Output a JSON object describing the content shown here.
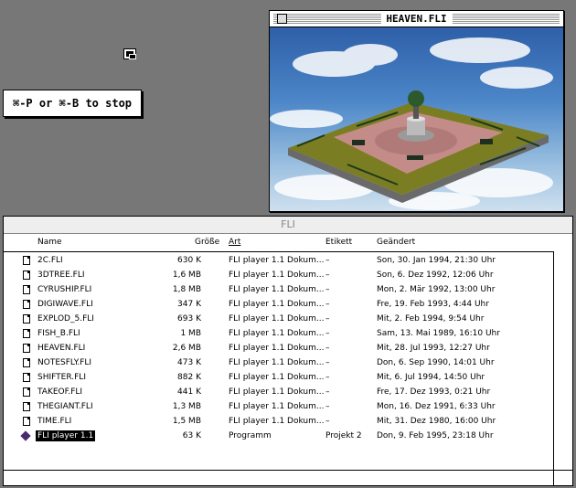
{
  "desktop": {
    "stop_message": "⌘-P or ⌘-B to stop",
    "small_icon": "window-icon"
  },
  "movie_window": {
    "title": "HEAVEN.FLI"
  },
  "finder": {
    "title": "FLI",
    "columns": {
      "name": "Name",
      "size": "Größe",
      "kind": "Art",
      "label": "Etikett",
      "modified": "Geändert"
    },
    "files": [
      {
        "name": "2C.FLI",
        "size": "630 K",
        "kind": "FLI player 1.1 Dokum...",
        "label": "–",
        "modified": "Son, 30. Jan 1994, 21:30 Uhr",
        "icon": "document-icon"
      },
      {
        "name": "3DTREE.FLI",
        "size": "1,6 MB",
        "kind": "FLI player 1.1 Dokum...",
        "label": "–",
        "modified": "Son, 6. Dez 1992, 12:06 Uhr",
        "icon": "document-icon"
      },
      {
        "name": "CYRUSHIP.FLI",
        "size": "1,8 MB",
        "kind": "FLI player 1.1 Dokum...",
        "label": "–",
        "modified": "Mon, 2. Mär 1992, 13:00 Uhr",
        "icon": "document-icon"
      },
      {
        "name": "DIGIWAVE.FLI",
        "size": "347 K",
        "kind": "FLI player 1.1 Dokum...",
        "label": "–",
        "modified": "Fre, 19. Feb 1993, 4:44 Uhr",
        "icon": "document-icon"
      },
      {
        "name": "EXPLOD_5.FLI",
        "size": "693 K",
        "kind": "FLI player 1.1 Dokum...",
        "label": "–",
        "modified": "Mit, 2. Feb 1994, 9:54 Uhr",
        "icon": "document-icon"
      },
      {
        "name": "FISH_B.FLI",
        "size": "1 MB",
        "kind": "FLI player 1.1 Dokum...",
        "label": "–",
        "modified": "Sam, 13. Mai 1989, 16:10 Uhr",
        "icon": "document-icon"
      },
      {
        "name": "HEAVEN.FLI",
        "size": "2,6 MB",
        "kind": "FLI player 1.1 Dokum...",
        "label": "–",
        "modified": "Mit, 28. Jul 1993, 12:27 Uhr",
        "icon": "document-icon"
      },
      {
        "name": "NOTESFLY.FLI",
        "size": "473 K",
        "kind": "FLI player 1.1 Dokum...",
        "label": "–",
        "modified": "Don, 6. Sep 1990, 14:01 Uhr",
        "icon": "document-icon"
      },
      {
        "name": "SHIFTER.FLI",
        "size": "882 K",
        "kind": "FLI player 1.1 Dokum...",
        "label": "–",
        "modified": "Mit, 6. Jul 1994, 14:50 Uhr",
        "icon": "document-icon"
      },
      {
        "name": "TAKEOF.FLI",
        "size": "441 K",
        "kind": "FLI player 1.1 Dokum...",
        "label": "–",
        "modified": "Fre, 17. Dez 1993, 0:21 Uhr",
        "icon": "document-icon"
      },
      {
        "name": "THEGIANT.FLI",
        "size": "1,3 MB",
        "kind": "FLI player 1.1 Dokum...",
        "label": "–",
        "modified": "Mon, 16. Dez 1991, 6:33 Uhr",
        "icon": "document-icon"
      },
      {
        "name": "TIME.FLI",
        "size": "1,5 MB",
        "kind": "FLI player 1.1 Dokum...",
        "label": "–",
        "modified": "Mit, 31. Dez 1980, 16:00 Uhr",
        "icon": "document-icon"
      },
      {
        "name": "FLI player 1.1",
        "size": "63 K",
        "kind": "Programm",
        "label": "Projekt 2",
        "modified": "Don, 9. Feb 1995, 23:18 Uhr",
        "icon": "application-icon",
        "selected": true
      }
    ]
  }
}
